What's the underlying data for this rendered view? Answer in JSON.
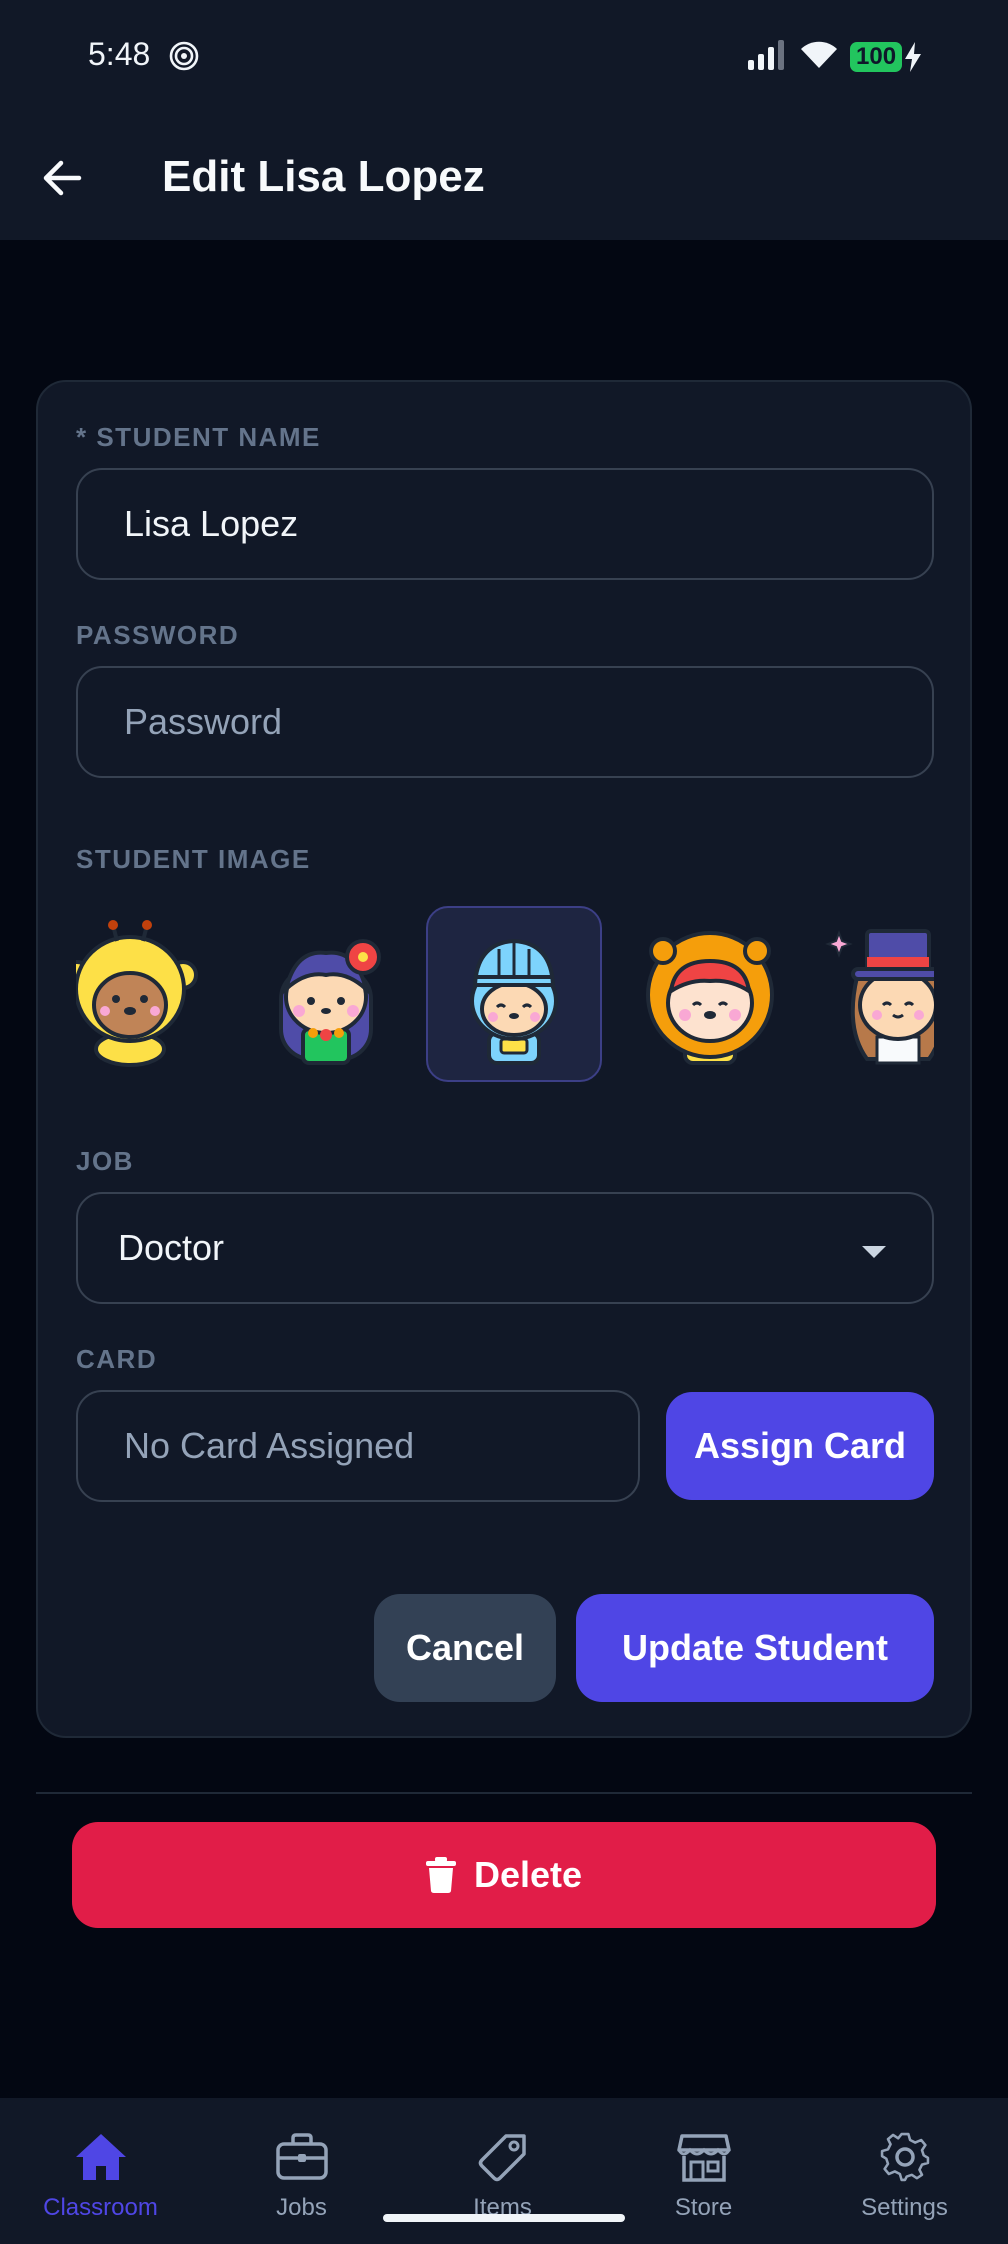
{
  "status_bar": {
    "time": "5:48",
    "battery": "100"
  },
  "header": {
    "title": "Edit Lisa Lopez"
  },
  "form": {
    "student_name": {
      "label": "* STUDENT NAME",
      "value": "Lisa Lopez"
    },
    "password": {
      "label": "PASSWORD",
      "placeholder": "Password"
    },
    "student_image": {
      "label": "STUDENT IMAGE",
      "avatars": [
        "giraffe",
        "flower-girl",
        "knight",
        "lion",
        "magician"
      ],
      "selected": "knight"
    },
    "job": {
      "label": "JOB",
      "value": "Doctor"
    },
    "card": {
      "label": "CARD",
      "placeholder": "No Card Assigned",
      "assign_label": "Assign Card"
    },
    "cancel_label": "Cancel",
    "update_label": "Update Student"
  },
  "delete_label": "Delete",
  "tab_bar": {
    "items": [
      {
        "label": "Classroom",
        "icon": "home-icon",
        "active": true
      },
      {
        "label": "Jobs",
        "icon": "briefcase-icon",
        "active": false
      },
      {
        "label": "Items",
        "icon": "tag-icon",
        "active": false
      },
      {
        "label": "Store",
        "icon": "store-icon",
        "active": false
      },
      {
        "label": "Settings",
        "icon": "gear-icon",
        "active": false
      }
    ]
  },
  "colors": {
    "background": "#030712",
    "surface": "#111827",
    "accent": "#4f46e5",
    "danger": "#e11d48",
    "battery": "#22c55e"
  }
}
